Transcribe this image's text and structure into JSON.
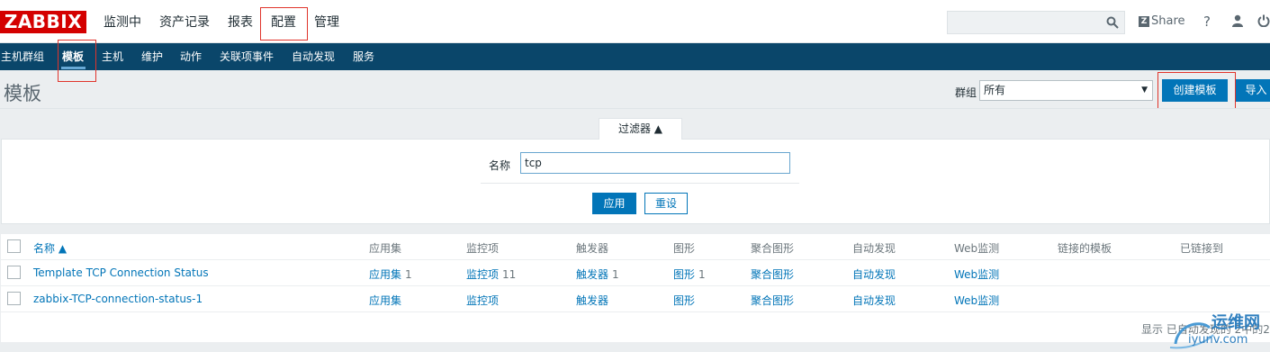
{
  "app": {
    "logo": "ZABBIX"
  },
  "topnav": {
    "items": [
      "监测中",
      "资产记录",
      "报表",
      "配置",
      "管理"
    ],
    "active": "配置"
  },
  "header_tools": {
    "share_label": "Share",
    "help": "?"
  },
  "subnav": {
    "items": [
      "主机群组",
      "模板",
      "主机",
      "维护",
      "动作",
      "关联项事件",
      "自动发现",
      "服务"
    ],
    "active": "模板"
  },
  "page": {
    "title": "模板",
    "group_label": "群组",
    "group_value": "所有",
    "create_button": "创建模板",
    "import_button": "导入"
  },
  "filter": {
    "tab_label": "过滤器 ▲",
    "name_label": "名称",
    "name_value": "tcp",
    "apply": "应用",
    "reset": "重设"
  },
  "table": {
    "headers": [
      "名称 ▲",
      "应用集",
      "监控项",
      "触发器",
      "图形",
      "聚合图形",
      "自动发现",
      "Web监测",
      "链接的模板",
      "已链接到"
    ],
    "rows": [
      {
        "name": "Template TCP Connection Status",
        "apps": "应用集",
        "apps_count": "1",
        "items": "监控项",
        "items_count": "11",
        "triggers": "触发器",
        "triggers_count": "1",
        "graphs": "图形",
        "graphs_count": "1",
        "screens": "聚合图形",
        "discovery": "自动发现",
        "web": "Web监测"
      },
      {
        "name": "zabbix-TCP-connection-status-1",
        "apps": "应用集",
        "apps_count": "",
        "items": "监控项",
        "items_count": "",
        "triggers": "触发器",
        "triggers_count": "",
        "graphs": "图形",
        "graphs_count": "",
        "screens": "聚合图形",
        "discovery": "自动发现",
        "web": "Web监测"
      }
    ],
    "footer": "显示 已自动发现的 2中的2"
  },
  "watermark": {
    "text1": "运维网",
    "text2": "iyunv.com"
  },
  "colors": {
    "brand": "#d40000",
    "subnav": "#0a466a",
    "link": "#0275b8",
    "highlight_box": "#e0342c"
  }
}
